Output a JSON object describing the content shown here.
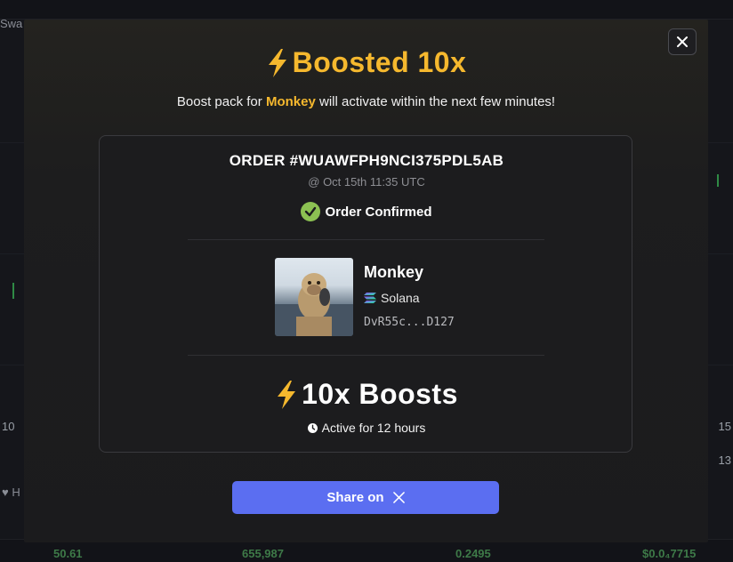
{
  "background": {
    "swap_label": "Swa",
    "left_axis_label": "10",
    "right_axis_label": "15",
    "right_axis_label_2": "13",
    "heart_label": "H",
    "row_values": [
      "50.61",
      "655,987",
      "0.2495",
      "$0.0₄7715"
    ]
  },
  "modal": {
    "title_icon": "lightning-bolt-icon",
    "title": "Boosted 10x",
    "subtitle_prefix": "Boost pack for ",
    "subtitle_token": "Monkey",
    "subtitle_suffix": " will activate within the next few minutes!",
    "close_icon": "close-icon"
  },
  "order": {
    "title": "ORDER #WUAWFPH9NCI375PDL5AB",
    "time": "@ Oct 15th 11:35 UTC",
    "status": "Order Confirmed",
    "status_icon": "check-circle-icon",
    "status_color": "#8cc152"
  },
  "token": {
    "name": "Monkey",
    "chain": "Solana",
    "chain_icon": "solana-icon",
    "address": "DvR55c...D127"
  },
  "boost": {
    "icon": "lightning-bolt-icon",
    "label": "10x Boosts",
    "duration": "Active for 12 hours",
    "duration_icon": "clock-icon"
  },
  "share": {
    "label": "Share on",
    "icon": "x-logo-icon"
  },
  "colors": {
    "accent": "#f5b82e",
    "button": "#5b6ef1"
  }
}
